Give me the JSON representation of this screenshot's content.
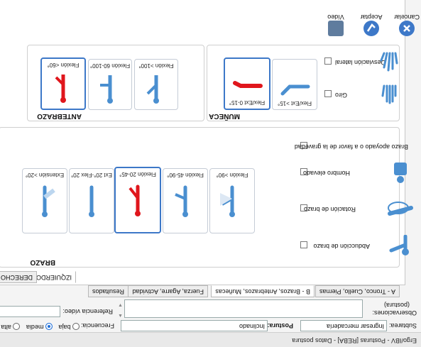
{
  "window_title": "Ergo/IBV - Posturas [REBA] - Datos postura",
  "buttons": {
    "video": "Vídeo",
    "accept": "Aceptar",
    "cancel": "Cancelar"
  },
  "fields": {
    "subtarea_label": "Subtarea:",
    "subtarea_value": "Ingresar mercadería",
    "postura_label": "Postura:",
    "postura_value": "Inclinado",
    "observaciones_label": "Observaciones:",
    "observaciones_sub": "(postura)",
    "referencia_label": "Referencia vídeo:",
    "frecuencia_label": "Frecuencia:",
    "frecuencia_options": [
      "baja",
      "media",
      "alta"
    ],
    "frecuencia_selected": "media"
  },
  "tabs": [
    "A - Tronco, Cuello, Piernas",
    "B - Brazos, Antebrazos, Muñecas",
    "Fuerza, Agarre, Actividad",
    "Resultados"
  ],
  "active_tab": "B - Brazos, Antebrazos, Muñecas",
  "side_tabs": {
    "left": "IZQUIERDO",
    "right": "DERECHO"
  },
  "brazo": {
    "title": "BRAZO",
    "options": [
      "Extensión >20°",
      "Ext 20°-Flex 20°",
      "Flexión 20-45°",
      "Flexión 45-90°",
      "Flexión >90°"
    ],
    "selected": "Flexión 20-45°",
    "checks": [
      "Brazo apoyado o a favor de la gravedad",
      "Hombro elevado",
      "Rotación de brazo",
      "Abducción de brazo"
    ]
  },
  "antebrazo": {
    "title": "ANTEBRAZO",
    "options": [
      "Flexión <60°",
      "Flexión 60-100°",
      "Flexión >100°"
    ],
    "selected": "Flexión <60°"
  },
  "muneca": {
    "title": "MUÑECA",
    "options": [
      "Flex/Ext 0-15°",
      "Flex/Ext >15°"
    ],
    "selected": "Flex/Ext 0-15°",
    "checks": [
      "Desviación lateral",
      "Giro"
    ]
  },
  "colors": {
    "selected_figure": "#e0161c",
    "figure": "#4a8fd0",
    "accent": "#1e6fd9"
  }
}
